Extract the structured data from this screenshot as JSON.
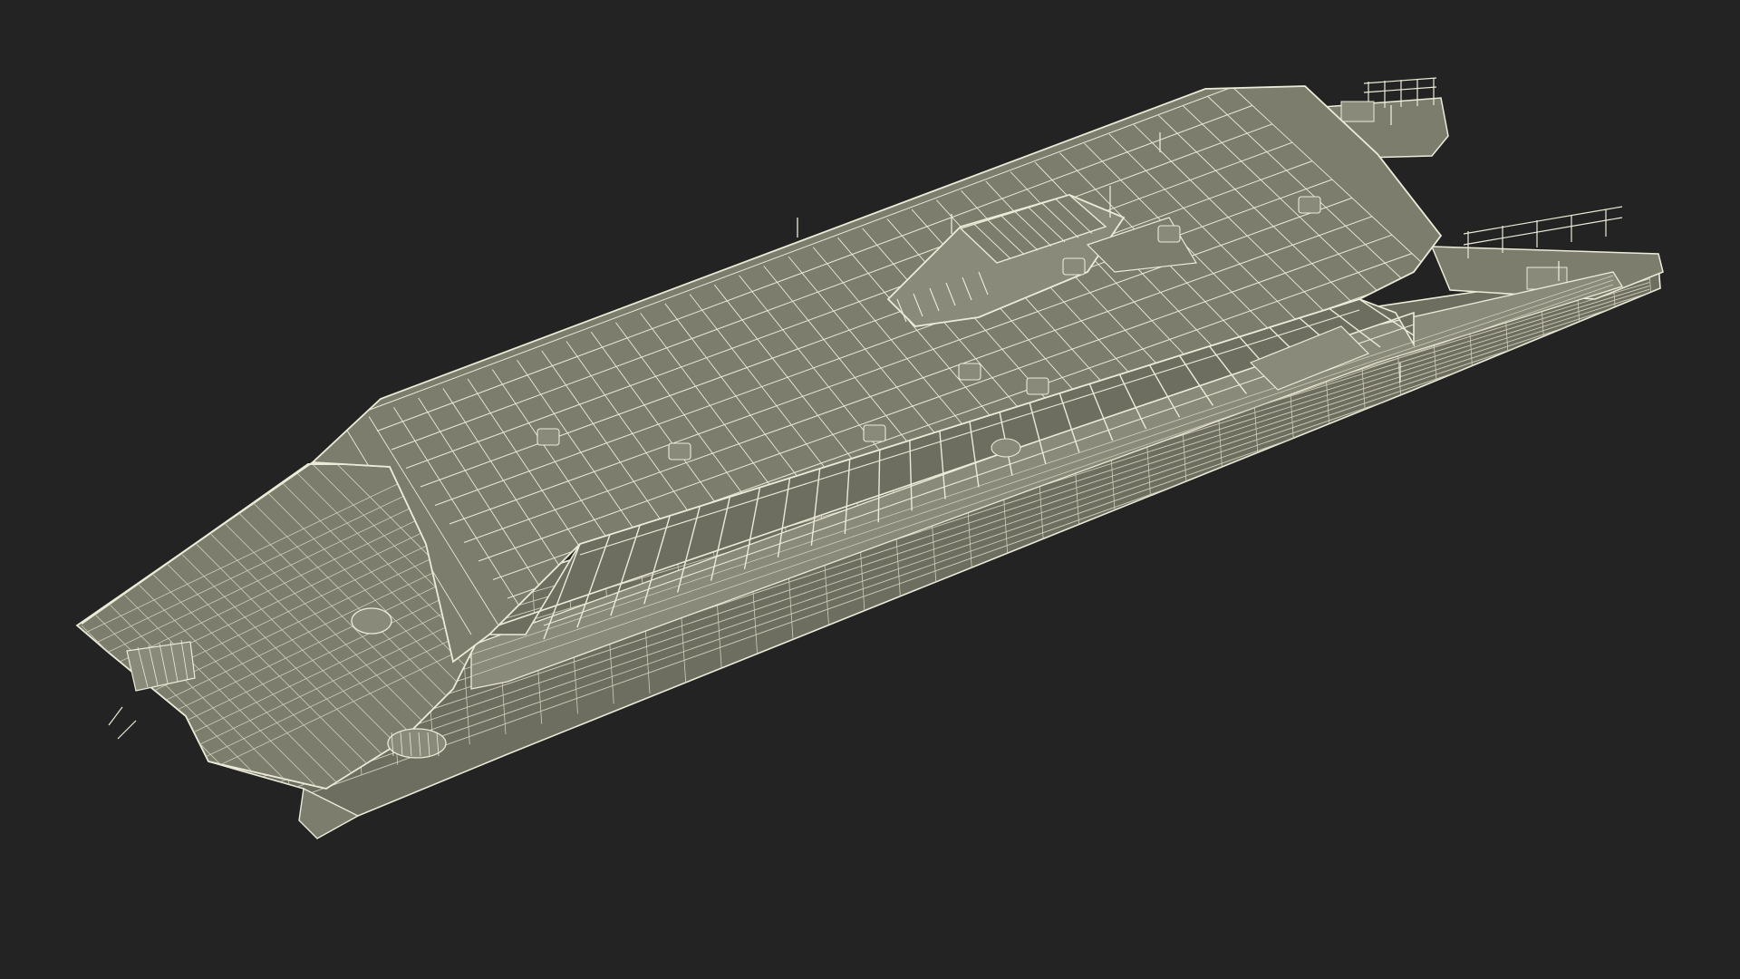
{
  "scene": {
    "subject": "catamaran-ferry-wireframe",
    "colors": {
      "background": "#232323",
      "surface": "#7d7d6e",
      "surface_dark": "#6e6e60",
      "surface_light": "#8a8a7a",
      "wire": "#ecebd8",
      "wire_dim": "#cfcdb9",
      "shadow": "#3a3a33"
    }
  }
}
